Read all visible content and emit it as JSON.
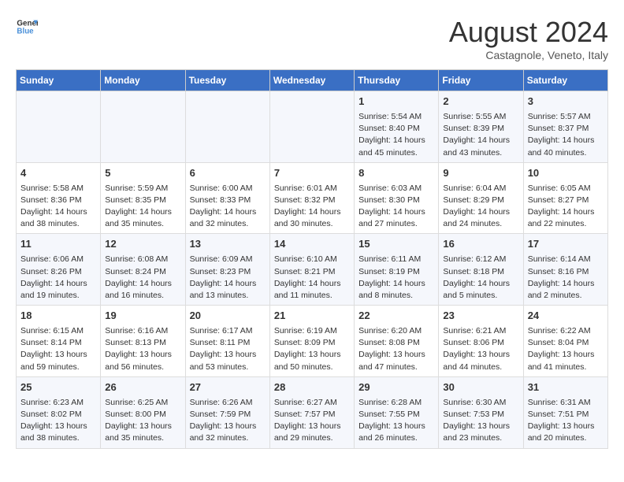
{
  "header": {
    "logo_line1": "General",
    "logo_line2": "Blue",
    "month_year": "August 2024",
    "location": "Castagnole, Veneto, Italy"
  },
  "days_of_week": [
    "Sunday",
    "Monday",
    "Tuesday",
    "Wednesday",
    "Thursday",
    "Friday",
    "Saturday"
  ],
  "weeks": [
    [
      {
        "day": "",
        "info": ""
      },
      {
        "day": "",
        "info": ""
      },
      {
        "day": "",
        "info": ""
      },
      {
        "day": "",
        "info": ""
      },
      {
        "day": "1",
        "info": "Sunrise: 5:54 AM\nSunset: 8:40 PM\nDaylight: 14 hours and 45 minutes."
      },
      {
        "day": "2",
        "info": "Sunrise: 5:55 AM\nSunset: 8:39 PM\nDaylight: 14 hours and 43 minutes."
      },
      {
        "day": "3",
        "info": "Sunrise: 5:57 AM\nSunset: 8:37 PM\nDaylight: 14 hours and 40 minutes."
      }
    ],
    [
      {
        "day": "4",
        "info": "Sunrise: 5:58 AM\nSunset: 8:36 PM\nDaylight: 14 hours and 38 minutes."
      },
      {
        "day": "5",
        "info": "Sunrise: 5:59 AM\nSunset: 8:35 PM\nDaylight: 14 hours and 35 minutes."
      },
      {
        "day": "6",
        "info": "Sunrise: 6:00 AM\nSunset: 8:33 PM\nDaylight: 14 hours and 32 minutes."
      },
      {
        "day": "7",
        "info": "Sunrise: 6:01 AM\nSunset: 8:32 PM\nDaylight: 14 hours and 30 minutes."
      },
      {
        "day": "8",
        "info": "Sunrise: 6:03 AM\nSunset: 8:30 PM\nDaylight: 14 hours and 27 minutes."
      },
      {
        "day": "9",
        "info": "Sunrise: 6:04 AM\nSunset: 8:29 PM\nDaylight: 14 hours and 24 minutes."
      },
      {
        "day": "10",
        "info": "Sunrise: 6:05 AM\nSunset: 8:27 PM\nDaylight: 14 hours and 22 minutes."
      }
    ],
    [
      {
        "day": "11",
        "info": "Sunrise: 6:06 AM\nSunset: 8:26 PM\nDaylight: 14 hours and 19 minutes."
      },
      {
        "day": "12",
        "info": "Sunrise: 6:08 AM\nSunset: 8:24 PM\nDaylight: 14 hours and 16 minutes."
      },
      {
        "day": "13",
        "info": "Sunrise: 6:09 AM\nSunset: 8:23 PM\nDaylight: 14 hours and 13 minutes."
      },
      {
        "day": "14",
        "info": "Sunrise: 6:10 AM\nSunset: 8:21 PM\nDaylight: 14 hours and 11 minutes."
      },
      {
        "day": "15",
        "info": "Sunrise: 6:11 AM\nSunset: 8:19 PM\nDaylight: 14 hours and 8 minutes."
      },
      {
        "day": "16",
        "info": "Sunrise: 6:12 AM\nSunset: 8:18 PM\nDaylight: 14 hours and 5 minutes."
      },
      {
        "day": "17",
        "info": "Sunrise: 6:14 AM\nSunset: 8:16 PM\nDaylight: 14 hours and 2 minutes."
      }
    ],
    [
      {
        "day": "18",
        "info": "Sunrise: 6:15 AM\nSunset: 8:14 PM\nDaylight: 13 hours and 59 minutes."
      },
      {
        "day": "19",
        "info": "Sunrise: 6:16 AM\nSunset: 8:13 PM\nDaylight: 13 hours and 56 minutes."
      },
      {
        "day": "20",
        "info": "Sunrise: 6:17 AM\nSunset: 8:11 PM\nDaylight: 13 hours and 53 minutes."
      },
      {
        "day": "21",
        "info": "Sunrise: 6:19 AM\nSunset: 8:09 PM\nDaylight: 13 hours and 50 minutes."
      },
      {
        "day": "22",
        "info": "Sunrise: 6:20 AM\nSunset: 8:08 PM\nDaylight: 13 hours and 47 minutes."
      },
      {
        "day": "23",
        "info": "Sunrise: 6:21 AM\nSunset: 8:06 PM\nDaylight: 13 hours and 44 minutes."
      },
      {
        "day": "24",
        "info": "Sunrise: 6:22 AM\nSunset: 8:04 PM\nDaylight: 13 hours and 41 minutes."
      }
    ],
    [
      {
        "day": "25",
        "info": "Sunrise: 6:23 AM\nSunset: 8:02 PM\nDaylight: 13 hours and 38 minutes."
      },
      {
        "day": "26",
        "info": "Sunrise: 6:25 AM\nSunset: 8:00 PM\nDaylight: 13 hours and 35 minutes."
      },
      {
        "day": "27",
        "info": "Sunrise: 6:26 AM\nSunset: 7:59 PM\nDaylight: 13 hours and 32 minutes."
      },
      {
        "day": "28",
        "info": "Sunrise: 6:27 AM\nSunset: 7:57 PM\nDaylight: 13 hours and 29 minutes."
      },
      {
        "day": "29",
        "info": "Sunrise: 6:28 AM\nSunset: 7:55 PM\nDaylight: 13 hours and 26 minutes."
      },
      {
        "day": "30",
        "info": "Sunrise: 6:30 AM\nSunset: 7:53 PM\nDaylight: 13 hours and 23 minutes."
      },
      {
        "day": "31",
        "info": "Sunrise: 6:31 AM\nSunset: 7:51 PM\nDaylight: 13 hours and 20 minutes."
      }
    ]
  ]
}
